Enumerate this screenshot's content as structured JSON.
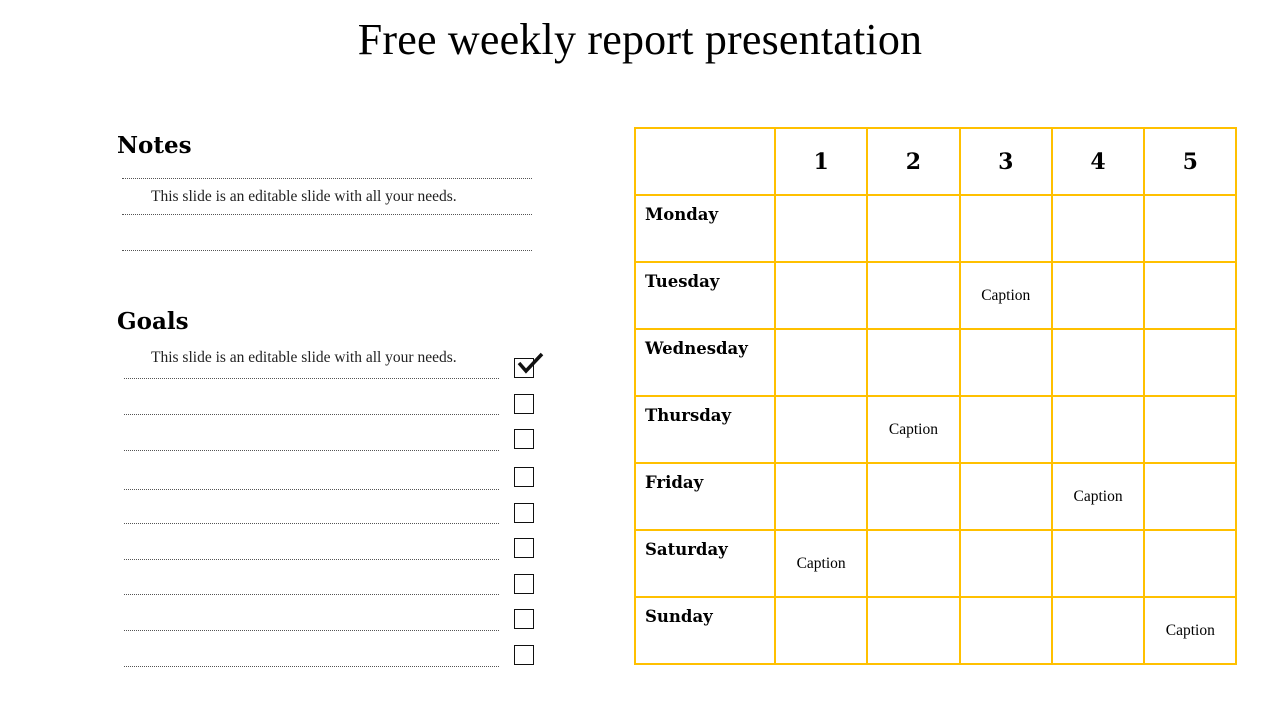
{
  "title": "Free weekly report presentation",
  "notes": {
    "heading": "Notes",
    "lines": [
      "This slide is an editable slide with all your needs.",
      ""
    ]
  },
  "goals": {
    "heading": "Goals",
    "intro": "This slide is an editable slide with all your needs.",
    "items": [
      {
        "checked": true
      },
      {
        "checked": false
      },
      {
        "checked": false
      },
      {
        "checked": false
      },
      {
        "checked": false
      },
      {
        "checked": false
      },
      {
        "checked": false
      },
      {
        "checked": false
      },
      {
        "checked": false
      }
    ]
  },
  "schedule": {
    "border_color": "#FFC000",
    "columns": [
      "1",
      "2",
      "3",
      "4",
      "5"
    ],
    "rows": [
      {
        "day": "Monday",
        "cells": [
          "",
          "",
          "",
          "",
          ""
        ]
      },
      {
        "day": "Tuesday",
        "cells": [
          "",
          "",
          "Caption",
          "",
          ""
        ]
      },
      {
        "day": "Wednesday",
        "cells": [
          "",
          "",
          "",
          "",
          ""
        ]
      },
      {
        "day": "Thursday",
        "cells": [
          "",
          "Caption",
          "",
          "",
          ""
        ]
      },
      {
        "day": "Friday",
        "cells": [
          "",
          "",
          "",
          "Caption",
          ""
        ]
      },
      {
        "day": "Saturday",
        "cells": [
          "Caption",
          "",
          "",
          "",
          ""
        ]
      },
      {
        "day": "Sunday",
        "cells": [
          "",
          "",
          "",
          "",
          "Caption"
        ]
      }
    ]
  }
}
